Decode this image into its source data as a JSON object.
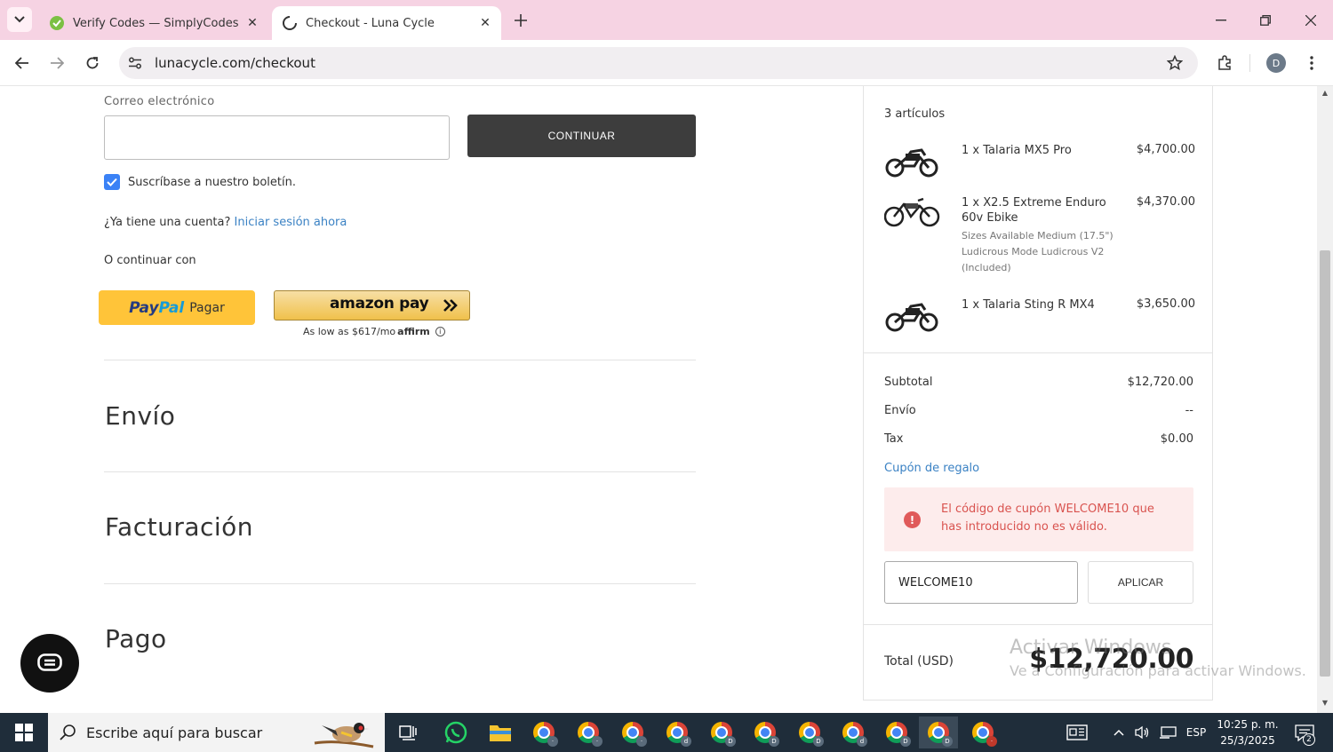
{
  "browser": {
    "tabs": [
      {
        "title": "Verify Codes — SimplyCodes",
        "active": false
      },
      {
        "title": "Checkout - Luna Cycle",
        "active": true
      }
    ],
    "url": "lunacycle.com/checkout",
    "profile_initial": "D"
  },
  "contact": {
    "email_label": "Correo electrónico",
    "email_value": "",
    "continue_label": "CONTINUAR",
    "newsletter_label": "Suscríbase a nuestro boletín.",
    "newsletter_checked": true,
    "account_prompt": "¿Ya tiene una cuenta?",
    "login_link": "Iniciar sesión ahora",
    "or_continue": "O continuar con"
  },
  "express": {
    "paypal_pay": "Pay",
    "paypal_pal": "Pal",
    "paypal_label": "Pagar",
    "amazon_label": "amazon pay",
    "affirm_text": "As low as $617/mo",
    "affirm_brand": "affirm"
  },
  "sections": [
    "Envío",
    "Facturación",
    "Pago"
  ],
  "summary": {
    "items_count": "3 artículos",
    "items": [
      {
        "name": "1 x Talaria MX5 Pro",
        "options": [],
        "price": "$4,700.00",
        "icon": "dirt-bike-icon"
      },
      {
        "name": "1 x X2.5 Extreme Enduro 60v Ebike",
        "options": [
          "Sizes Available Medium (17.5\")",
          "Ludicrous Mode Ludicrous V2",
          "(Included)"
        ],
        "price": "$4,370.00",
        "icon": "ebike-icon"
      },
      {
        "name": "1 x Talaria Sting R MX4",
        "options": [],
        "price": "$3,650.00",
        "icon": "dirt-bike-icon"
      }
    ],
    "subtotal_label": "Subtotal",
    "subtotal_value": "$12,720.00",
    "shipping_label": "Envío",
    "shipping_value": "--",
    "tax_label": "Tax",
    "tax_value": "$0.00",
    "coupon_link": "Cupón de regalo",
    "error_message": "El código de cupón WELCOME10 que has introducido no es válido.",
    "coupon_value": "WELCOME10",
    "apply_label": "APLICAR",
    "total_label": "Total (USD)",
    "total_value": "$12,720.00"
  },
  "watermark": {
    "line1": "Activar Windows",
    "line2": "Ve a Configuración para activar Windows."
  },
  "taskbar": {
    "search_placeholder": "Escribe aquí para buscar",
    "language": "ESP",
    "time": "10:25 p. m.",
    "date": "25/3/2025",
    "notifications": "2"
  },
  "colors": {
    "tabbar": "#f6d3e3",
    "link": "#3b82c4",
    "checkbox": "#3b82f6",
    "paypal": "#ffc439",
    "error_bg": "#fdecec",
    "error_text": "#d9534f",
    "taskbar": "#1f2d3a"
  }
}
